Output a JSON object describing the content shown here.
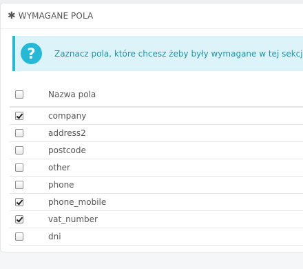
{
  "panel": {
    "title": "WYMAGANE POLA",
    "heading_icon": "asterisk-icon"
  },
  "alert": {
    "icon": "question-icon",
    "icon_glyph": "?",
    "text": "Zaznacz pola, które chcesz żeby były wymagane w tej sekcji."
  },
  "table": {
    "header": {
      "column_name": "Nazwa pola",
      "select_all_checked": false
    },
    "rows": [
      {
        "name": "company",
        "checked": true
      },
      {
        "name": "address2",
        "checked": false
      },
      {
        "name": "postcode",
        "checked": false
      },
      {
        "name": "other",
        "checked": false
      },
      {
        "name": "phone",
        "checked": false
      },
      {
        "name": "phone_mobile",
        "checked": true
      },
      {
        "name": "vat_number",
        "checked": true
      },
      {
        "name": "dni",
        "checked": false
      }
    ]
  },
  "colors": {
    "accent": "#25b9d7",
    "alert_background": "#dcf4f9",
    "alert_text": "#1e94ab",
    "page_background": "#eef1f4"
  }
}
